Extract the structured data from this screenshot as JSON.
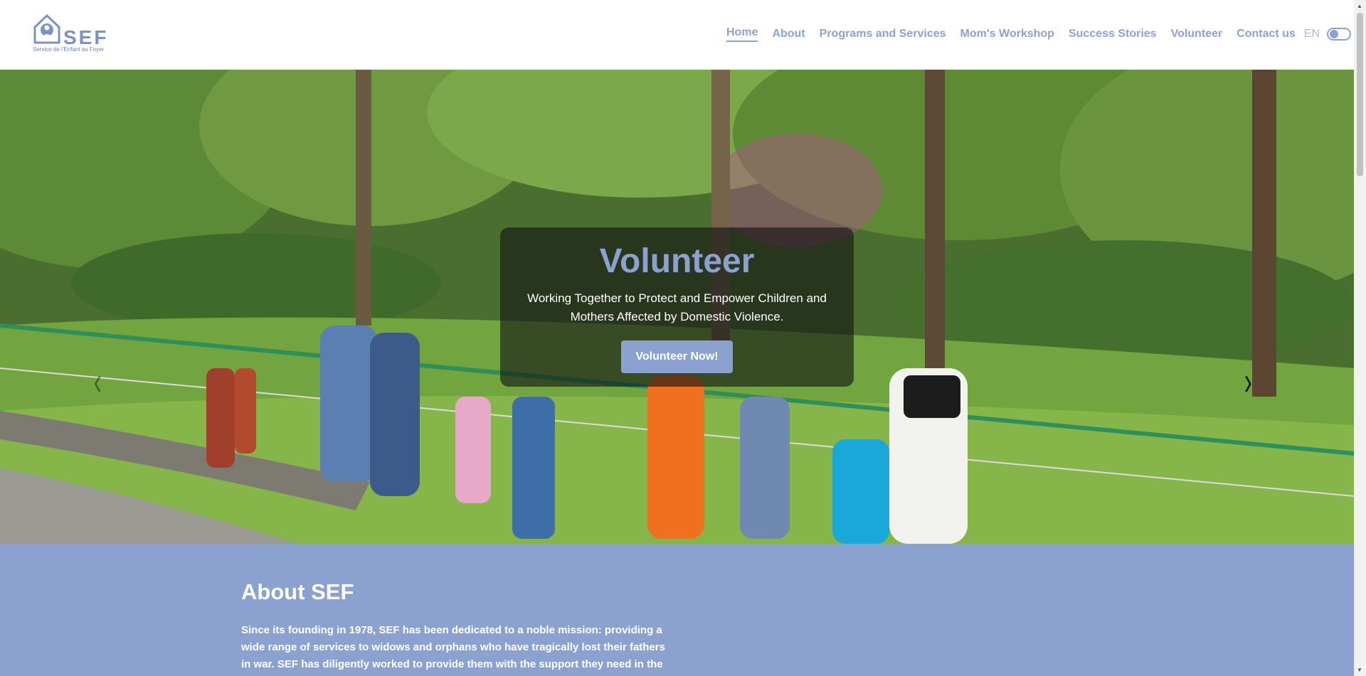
{
  "brand": {
    "name": "SEF",
    "tagline": "Service de l'Enfant au Foyer",
    "color": "#8ba2d0"
  },
  "nav": {
    "items": [
      {
        "label": "Home",
        "active": true
      },
      {
        "label": "About"
      },
      {
        "label": "Programs and Services"
      },
      {
        "label": "Mom's Workshop"
      },
      {
        "label": "Success Stories"
      },
      {
        "label": "Volunteer"
      },
      {
        "label": "Contact us"
      }
    ],
    "language": "EN"
  },
  "hero": {
    "title": "Volunteer",
    "subtitle": "Working Together to Protect and Empower Children and Mothers Affected by Domestic Violence.",
    "button_label": "Volunteer Now!",
    "prev_icon": "‹",
    "next_icon": "›",
    "active_slide": 3,
    "slide_count": 3
  },
  "about": {
    "title": "About SEF",
    "text": "Since its founding in 1978, SEF has been dedicated to a noble mission: providing a wide range of services to widows and orphans who have tragically lost their fathers in war. SEF has diligently worked to provide them with the support they need in the"
  }
}
